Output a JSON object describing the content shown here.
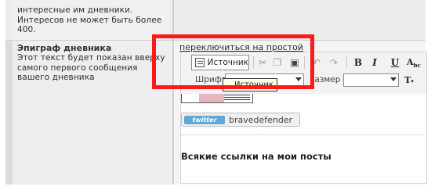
{
  "top_text": "интересные им дневники. Интересов не может быть более 400.",
  "epigraph": {
    "title": "Эпиграф дневника",
    "description": "Этот текст будет показан вверху самого первого сообщения вашего дневника"
  },
  "editor": {
    "switch_link": "переключиться на простой",
    "toolbar": {
      "source_label": "Источник",
      "tooltip": "Источник",
      "font_label": "Шрифт",
      "size_label": "Размер",
      "font_value": "",
      "size_value": "",
      "icons": [
        "source-icon",
        "cut-icon",
        "copy-icon",
        "paste-icon",
        "undo-icon",
        "redo-icon",
        "bold-icon",
        "italic-icon",
        "underline-icon",
        "strikethrough-icon",
        "text-color-icon"
      ]
    },
    "content": {
      "twitter_badge": "twitter",
      "twitter_user": "bravedefender",
      "links_heading": "Всякие ссылки на мои посты"
    }
  },
  "colors": {
    "highlight": "#ff1a1a",
    "twitter": "#5fa9d6"
  }
}
